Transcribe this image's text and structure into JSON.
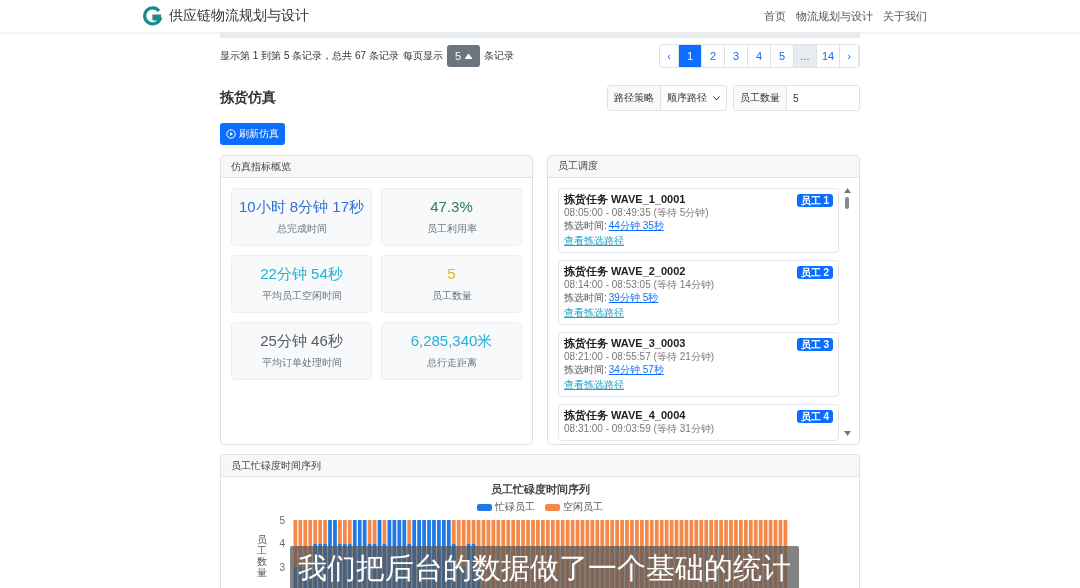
{
  "navbar": {
    "brand": "供应链物流规划与设计",
    "links": [
      {
        "label": "首页"
      },
      {
        "label": "物流规划与设计"
      },
      {
        "label": "关于我们"
      }
    ]
  },
  "pagination": {
    "summary": "显示第 1 到第 5 条记录，总共 67 条记录",
    "per_page_label": "每页显示",
    "per_page": "5",
    "per_page_suffix": "条记录",
    "pages": [
      {
        "label": "‹",
        "kind": "arrow",
        "selected": false
      },
      {
        "label": "1",
        "kind": "page",
        "selected": true
      },
      {
        "label": "2",
        "kind": "page",
        "selected": false
      },
      {
        "label": "3",
        "kind": "page",
        "selected": false
      },
      {
        "label": "4",
        "kind": "page",
        "selected": false
      },
      {
        "label": "5",
        "kind": "page",
        "selected": false
      },
      {
        "label": "...",
        "kind": "ellipsis",
        "selected": false
      },
      {
        "label": "14",
        "kind": "page",
        "selected": false
      },
      {
        "label": "›",
        "kind": "arrow",
        "selected": false
      }
    ]
  },
  "simulation": {
    "title": "拣货仿真",
    "strategy_label": "路径策略",
    "strategy": "顺序路径",
    "workers_label": "员工数量",
    "workers": "5",
    "refresh_button": "刷新仿真"
  },
  "metrics_panel": {
    "title": "仿真指标概览",
    "metrics": [
      {
        "value": "10小时 8分钟 17秒",
        "label": "总完成时间",
        "color": "#2f72cf"
      },
      {
        "value": "47.3%",
        "label": "员工利用率",
        "color": "#2e7d55"
      },
      {
        "value": "22分钟 54秒",
        "label": "平均员工空闲时间",
        "color": "#22b0d6"
      },
      {
        "value": "5",
        "label": "员工数量",
        "color": "#f0ad1c"
      },
      {
        "value": "25分钟 46秒",
        "label": "平均订单处理时间",
        "color": "#555b61"
      },
      {
        "value": "6,285,340米",
        "label": "总行走距离",
        "color": "#22b0d6"
      }
    ]
  },
  "schedule_panel": {
    "title": "员工调度",
    "tasks": [
      {
        "title": "拣货任务 WAVE_1_0001",
        "time": "08:05:00 - 08:49:35 (等待 5分钟)",
        "pick_label": "拣选时间:",
        "pick_time": "44分钟 35秒",
        "route_link": "查看拣选路径",
        "worker": "员工 1"
      },
      {
        "title": "拣货任务 WAVE_2_0002",
        "time": "08:14:00 - 08:53:05 (等待 14分钟)",
        "pick_label": "拣选时间:",
        "pick_time": "39分钟 5秒",
        "route_link": "查看拣选路径",
        "worker": "员工 2"
      },
      {
        "title": "拣货任务 WAVE_3_0003",
        "time": "08:21:00 - 08:55:57 (等待 21分钟)",
        "pick_label": "拣选时间:",
        "pick_time": "34分钟 57秒",
        "route_link": "查看拣选路径",
        "worker": "员工 3"
      },
      {
        "title": "拣货任务 WAVE_4_0004",
        "time": "08:31:00 - 09:03:59 (等待 31分钟)",
        "worker": "员工 4"
      }
    ]
  },
  "busy_panel": {
    "title": "员工忙碌度时间序列",
    "chart_title": "员工忙碌度时间序列",
    "y_axis_title": "员工数量",
    "y_ticks": [
      "5",
      "4",
      "3"
    ],
    "legend": [
      {
        "label": "忙碌员工",
        "color": "#1f7ae8"
      },
      {
        "label": "空闲员工",
        "color": "#f5894a"
      }
    ]
  },
  "subtitle": "我们把后台的数据做了一个基础的统计"
}
